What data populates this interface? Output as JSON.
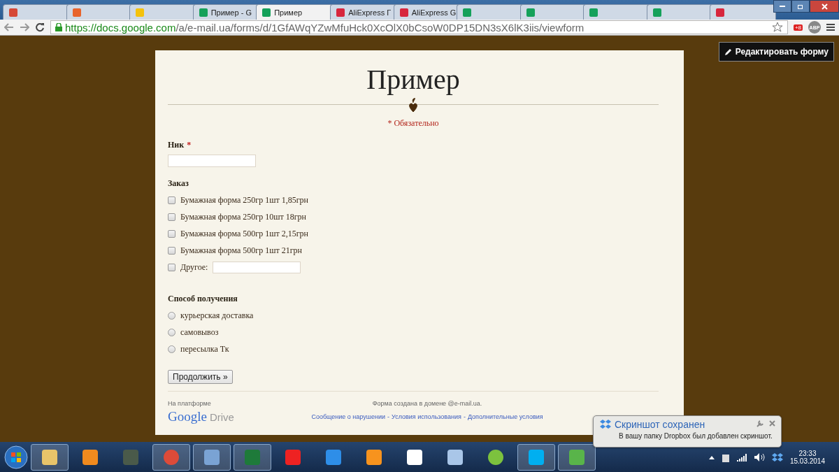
{
  "browser": {
    "tabs": [
      {
        "kind": "mail",
        "selected": false
      },
      {
        "kind": "doc",
        "selected": false
      },
      {
        "kind": "drive",
        "selected": false
      },
      {
        "kind": "sheet",
        "title": "Пример - G",
        "selected": false
      },
      {
        "kind": "sheet",
        "title": "Пример",
        "selected": true
      },
      {
        "kind": "ali",
        "title": "AliExpress Г",
        "selected": false
      },
      {
        "kind": "ali",
        "title": "AliExpress G",
        "selected": false
      },
      {
        "kind": "sheet",
        "selected": false
      },
      {
        "kind": "sheet",
        "selected": false
      },
      {
        "kind": "sheet",
        "selected": false
      },
      {
        "kind": "sheet",
        "selected": false
      },
      {
        "kind": "ali",
        "selected": false
      }
    ],
    "url_host": "https://docs.google.com",
    "url_path": "/a/e-mail.ua/forms/d/1GfAWqYZwMfuHck0XcOlX0bCsoW0DP15DN3sX6lK3iis/viewform",
    "extension_badge": "+8",
    "abp": "ABP"
  },
  "edit_button": "Редактировать форму",
  "form": {
    "title": "Пример",
    "required_note": "* Обязательно",
    "questions": [
      {
        "kind": "text",
        "label": "Ник",
        "required_mark": "*"
      },
      {
        "kind": "checkbox",
        "label": "Заказ",
        "options": [
          {
            "kind": "plain",
            "label": "Бумажная форма 250гр 1шт 1,85грн",
            "checked": false
          },
          {
            "kind": "plain",
            "label": "Бумажная форма 250гр 10шт 18грн",
            "checked": false
          },
          {
            "kind": "plain",
            "label": "Бумажная форма 500гр 1шт 2,15грн",
            "checked": false
          },
          {
            "kind": "plain",
            "label": "Бумажная форма 500гр 1шт 21грн",
            "checked": false
          },
          {
            "kind": "other",
            "label": "Другое:",
            "checked": false
          }
        ]
      },
      {
        "kind": "radio",
        "label": "Способ получения",
        "options": [
          {
            "label": "курьерская доставка",
            "selected": false
          },
          {
            "label": "самовывоз",
            "selected": false
          },
          {
            "label": "пересылка Тк",
            "selected": false
          }
        ]
      }
    ],
    "submit": "Продолжить »",
    "footer": {
      "platform": "На платформе",
      "logo_google": "Google",
      "logo_drive": "Drive",
      "domain": "Форма создана в домене @e-mail.ua.",
      "links": [
        "Сообщение о нарушении",
        "Условия использования",
        "Дополнительные условия"
      ],
      "separator": "-"
    }
  },
  "notification": {
    "title": "Скриншот сохранен",
    "body": "В вашу папку Dropbox был добавлен скриншот."
  },
  "taskbar": {
    "apps": [
      {
        "kind": "folder",
        "active": true
      },
      {
        "kind": "player",
        "active": false
      },
      {
        "kind": "monitor",
        "active": false
      },
      {
        "kind": "chrome",
        "active": true
      },
      {
        "kind": "calc",
        "active": true
      },
      {
        "kind": "excel",
        "active": true
      },
      {
        "kind": "yandex-browser",
        "active": false
      },
      {
        "kind": "ie",
        "active": false
      },
      {
        "kind": "ok",
        "active": false
      },
      {
        "kind": "yandex",
        "active": false
      },
      {
        "kind": "sound",
        "active": false
      },
      {
        "kind": "ball",
        "active": false
      },
      {
        "kind": "skype",
        "active": true
      },
      {
        "kind": "network",
        "active": true
      }
    ],
    "time": "23:33",
    "date": "15.03.2014"
  }
}
